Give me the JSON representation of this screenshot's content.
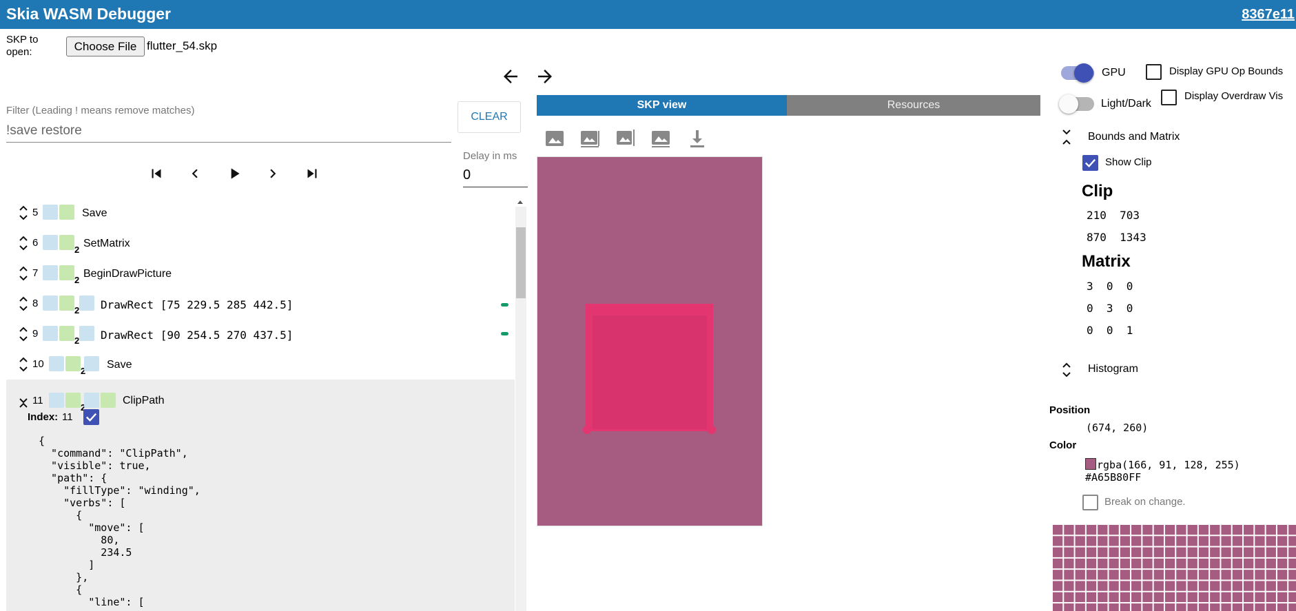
{
  "header": {
    "title": "Skia WASM Debugger",
    "version": "8367e11"
  },
  "file": {
    "label": "SKP to open:",
    "button": "Choose File",
    "name": "flutter_54.skp"
  },
  "filter": {
    "label": "Filter (Leading ! means remove matches)",
    "value": "!save restore",
    "clear": "CLEAR"
  },
  "playback": {
    "delay_label": "Delay in ms",
    "delay_value": "0"
  },
  "commands": [
    {
      "index": "5",
      "name": "Save"
    },
    {
      "index": "6",
      "name": "SetMatrix",
      "count": "2"
    },
    {
      "index": "7",
      "name": "BeginDrawPicture",
      "count": "2"
    },
    {
      "index": "8",
      "name": "DrawRect [75 229.5 285 442.5]",
      "count": "2"
    },
    {
      "index": "9",
      "name": "DrawRect [90 254.5 270 437.5]",
      "count": "2"
    },
    {
      "index": "10",
      "name": "Save",
      "count": "2"
    },
    {
      "index": "11",
      "name": "ClipPath",
      "count": "2"
    }
  ],
  "selected": {
    "index_label": "Index:",
    "index_value": "11",
    "json": "{\n  \"command\": \"ClipPath\",\n  \"visible\": true,\n  \"path\": {\n    \"fillType\": \"winding\",\n    \"verbs\": [\n      {\n        \"move\": [\n          80,\n          234.5\n        ]\n      },\n      {\n        \"line\": ["
  },
  "tabs": {
    "skp_view": "SKP view",
    "resources": "Resources"
  },
  "canvas": {
    "background": "#a65b80",
    "rect": "#e3356f"
  },
  "right_panel": {
    "gpu": "GPU",
    "light_dark": "Light/Dark",
    "gpu_op_bounds": "Display GPU Op Bounds",
    "overdraw": "Display Overdraw Vis",
    "bounds_matrix": "Bounds and Matrix",
    "show_clip": "Show Clip",
    "clip_heading": "Clip",
    "clip_rows": [
      "210  703",
      "870  1343"
    ],
    "matrix_heading": "Matrix",
    "matrix_rows": [
      "3  0  0",
      "0  3  0",
      "0  0  1"
    ],
    "histogram": "Histogram",
    "position_label": "Position",
    "position_value": "(674, 260)",
    "color_label": "Color",
    "color_rgba": "rgba(166, 91, 128, 255)",
    "color_hex": "#A65B80FF",
    "break_on_change": "Break on change."
  },
  "colors": {
    "accent": "#1f77b4",
    "toggle": "#3f51b5",
    "marker": "#159a6a"
  }
}
